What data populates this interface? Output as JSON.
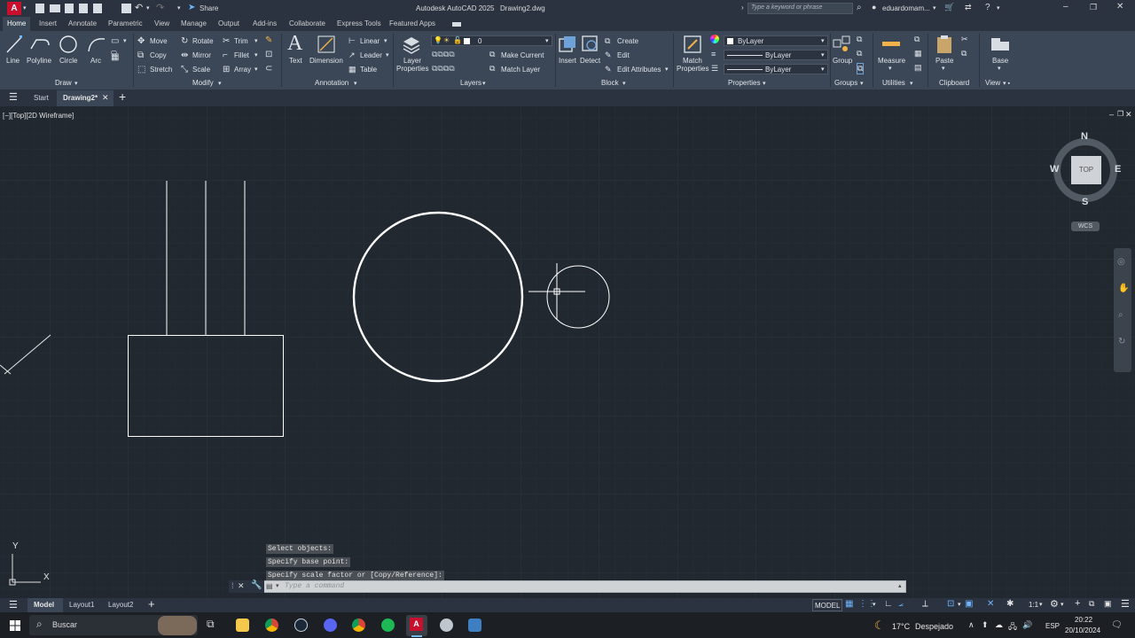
{
  "app_title": "Autodesk AutoCAD 2025",
  "file_name": "Drawing2.dwg",
  "quick_access": {
    "share_label": "Share"
  },
  "search": {
    "placeholder": "Type a keyword or phrase"
  },
  "user": {
    "name": "eduardomam..."
  },
  "ribbon_tabs": [
    "Home",
    "Insert",
    "Annotate",
    "Parametric",
    "View",
    "Manage",
    "Output",
    "Add-ins",
    "Collaborate",
    "Express Tools",
    "Featured Apps"
  ],
  "panels": {
    "draw": {
      "title": "Draw",
      "line": "Line",
      "polyline": "Polyline",
      "circle": "Circle",
      "arc": "Arc"
    },
    "modify": {
      "title": "Modify",
      "move": "Move",
      "rotate": "Rotate",
      "trim": "Trim",
      "copy": "Copy",
      "mirror": "Mirror",
      "fillet": "Fillet",
      "stretch": "Stretch",
      "scale": "Scale",
      "array": "Array"
    },
    "annotation": {
      "title": "Annotation",
      "text": "Text",
      "dimension": "Dimension",
      "linear": "Linear",
      "leader": "Leader",
      "table": "Table"
    },
    "layers": {
      "title": "Layers",
      "layer_properties_1": "Layer",
      "layer_properties_2": "Properties",
      "current_layer": "0",
      "make_current": "Make Current",
      "match_layer": "Match Layer"
    },
    "block": {
      "title": "Block",
      "insert": "Insert",
      "detect": "Detect",
      "create": "Create",
      "edit": "Edit",
      "edit_attributes": "Edit Attributes"
    },
    "properties": {
      "title": "Properties",
      "match_1": "Match",
      "match_2": "Properties",
      "color": "ByLayer",
      "linetype": "ByLayer",
      "lineweight": "ByLayer"
    },
    "groups": {
      "title": "Groups",
      "group": "Group"
    },
    "utilities": {
      "title": "Utilities",
      "measure": "Measure"
    },
    "clipboard": {
      "title": "Clipboard",
      "paste": "Paste"
    },
    "view": {
      "title": "View",
      "base": "Base"
    }
  },
  "doc_tabs": {
    "start": "Start",
    "active": "Drawing2*"
  },
  "viewport_label": "[−][Top][2D Wireframe]",
  "viewcube": {
    "top": "TOP",
    "n": "N",
    "s": "S",
    "e": "E",
    "w": "W",
    "wcs": "WCS"
  },
  "ucs": {
    "x": "X",
    "y": "Y"
  },
  "command_history": [
    "Select objects:",
    "Specify base point:",
    "Specify scale factor or [Copy/Reference]:"
  ],
  "command_prompt": "Type a command",
  "layouts": [
    "Model",
    "Layout1",
    "Layout2"
  ],
  "status": {
    "model": "MODEL",
    "scale": "1:1"
  },
  "taskbar": {
    "search": "Buscar",
    "weather_temp": "17°C",
    "weather_desc": "Despejado",
    "lang": "ESP",
    "time": "20:22",
    "date": "20/10/2024"
  }
}
